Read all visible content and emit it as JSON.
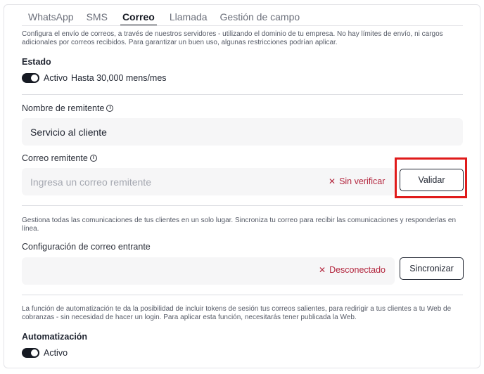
{
  "tabs": [
    {
      "label": "WhatsApp",
      "active": false
    },
    {
      "label": "SMS",
      "active": false
    },
    {
      "label": "Correo",
      "active": true
    },
    {
      "label": "Llamada",
      "active": false
    },
    {
      "label": "Gestión de campo",
      "active": false
    }
  ],
  "email_section": {
    "description": "Configura el envío de correos, a través de nuestros servidores - utilizando el dominio de tu empresa. No hay límites de envío, ni cargos adicionales por correos recibidos. Para garantizar un buen uso, algunas restricciones podrían aplicar.",
    "estado_title": "Estado",
    "estado_status": "Activo",
    "estado_limit": "Hasta 30,000 mens/mes",
    "sender_name_label": "Nombre de remitente",
    "sender_name_value": "Servicio al cliente",
    "sender_email_label": "Correo remitente",
    "sender_email_placeholder": "Ingresa un correo remitente",
    "sender_email_status": "Sin verificar",
    "validate_button": "Validar"
  },
  "incoming_section": {
    "description": "Gestiona todas las comunicaciones de tus clientes en un solo lugar. Sincroniza tu correo para recibir las comunicaciones y responderlas en línea.",
    "label": "Configuración de correo entrante",
    "status": "Desconectado",
    "sync_button": "Sincronizar"
  },
  "automation_section": {
    "description": "La función de automatización te da la posibilidad de incluir tokens de sesión tus correos salientes, para redirigir a tus clientes a tu Web de cobranzas - sin necesidad de hacer un login. Para aplicar esta función, necesitarás tener publicada la Web.",
    "title": "Automatización",
    "status": "Activo"
  },
  "colors": {
    "accent": "#161a23",
    "error": "#b3263e",
    "highlight": "#e01b1b",
    "field_bg": "#f6f6f7"
  },
  "icons": [
    "info-icon",
    "close-x-icon"
  ]
}
